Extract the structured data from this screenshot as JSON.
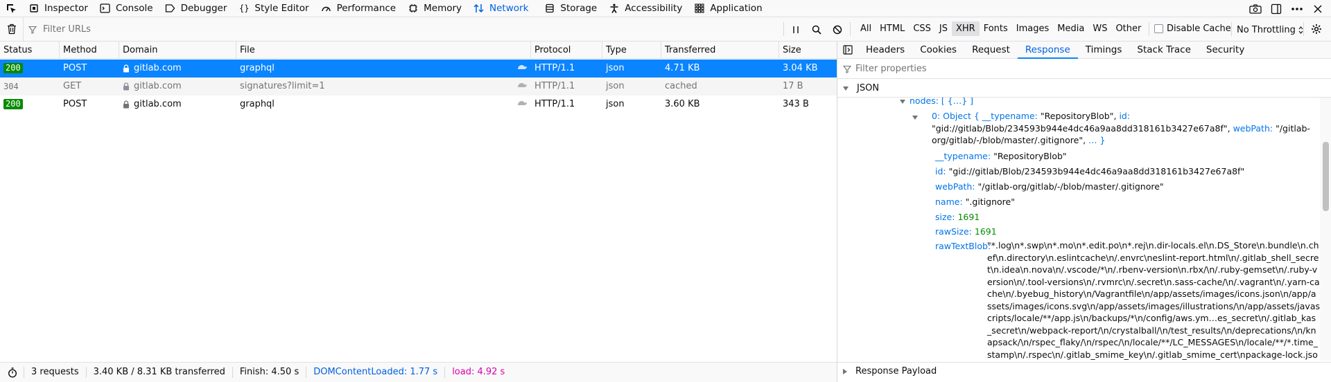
{
  "toolbox": {
    "tabs": [
      {
        "label": "Inspector",
        "icon": "inspector-icon"
      },
      {
        "label": "Console",
        "icon": "console-icon"
      },
      {
        "label": "Debugger",
        "icon": "debugger-icon"
      },
      {
        "label": "Style Editor",
        "icon": "style-editor-icon"
      },
      {
        "label": "Performance",
        "icon": "performance-icon"
      },
      {
        "label": "Memory",
        "icon": "memory-icon"
      },
      {
        "label": "Network",
        "icon": "network-icon",
        "selected": true
      },
      {
        "label": "Storage",
        "icon": "storage-icon"
      },
      {
        "label": "Accessibility",
        "icon": "accessibility-icon"
      },
      {
        "label": "Application",
        "icon": "application-icon"
      }
    ]
  },
  "network_toolbar": {
    "filter_placeholder": "Filter URLs",
    "type_filters": [
      "All",
      "HTML",
      "CSS",
      "JS",
      "XHR",
      "Fonts",
      "Images",
      "Media",
      "WS",
      "Other"
    ],
    "active_filter": "XHR",
    "disable_cache_label": "Disable Cache",
    "throttling_label": "No Throttling"
  },
  "table": {
    "headers": [
      "Status",
      "Method",
      "Domain",
      "File",
      "Protocol",
      "Type",
      "Transferred",
      "Size"
    ],
    "rows": [
      {
        "status": "200",
        "method": "POST",
        "domain": "gitlab.com",
        "file": "graphql",
        "protocol": "HTTP/1.1",
        "type": "json",
        "transferred": "4.71 KB",
        "size": "3.04 KB"
      },
      {
        "status": "304",
        "method": "GET",
        "domain": "gitlab.com",
        "file": "signatures?limit=1",
        "protocol": "HTTP/1.1",
        "type": "json",
        "transferred": "cached",
        "size": "17 B"
      },
      {
        "status": "200",
        "method": "POST",
        "domain": "gitlab.com",
        "file": "graphql",
        "protocol": "HTTP/1.1",
        "type": "json",
        "transferred": "3.60 KB",
        "size": "343 B"
      }
    ]
  },
  "statusbar": {
    "requests": "3 requests",
    "transferred": "3.40 KB / 8.31 KB transferred",
    "finish": "Finish: 4.50 s",
    "dcl": "DOMContentLoaded: 1.77 s",
    "load": "load: 4.92 s"
  },
  "side_panel": {
    "tabs": [
      "Headers",
      "Cookies",
      "Request",
      "Response",
      "Timings",
      "Stack Trace",
      "Security"
    ],
    "selected_tab": "Response",
    "filter_placeholder": "Filter properties",
    "json_section": "JSON",
    "payload_section": "Response Payload",
    "json": {
      "nodes_line_key": "nodes:",
      "nodes_line_val": "[ {…} ]",
      "obj_index": "0:",
      "obj_word": "Object",
      "obj_open": "{",
      "obj_typename_key": "__typename:",
      "obj_typename_val": "\"RepositoryBlob\"",
      "obj_id_key": "id:",
      "obj_id_val": "\"gid://gitlab/Blob/234593b944e4dc46a9aa8dd318161b3427e67a8f\"",
      "obj_webpath_key": "webPath:",
      "obj_webpath_val": "\"/gitlab-org/gitlab/-/blob/master/.gitignore\"",
      "obj_more": "… }",
      "typename_key": "__typename:",
      "typename_val": "\"RepositoryBlob\"",
      "id_key": "id:",
      "id_val": "\"gid://gitlab/Blob/234593b944e4dc46a9aa8dd318161b3427e67a8f\"",
      "webpath_key": "webPath:",
      "webpath_val": "\"/gitlab-org/gitlab/-/blob/master/.gitignore\"",
      "name_key": "name:",
      "name_val": "\".gitignore\"",
      "size_key": "size:",
      "size_val": "1691",
      "rawsize_key": "rawSize:",
      "rawsize_val": "1691",
      "rawtext_key": "rawTextBlob:",
      "rawtext_val": "\"*.log\\n*.swp\\n*.mo\\n*.edit.po\\n*.rej\\n.dir-locals.el\\n.DS_Store\\n.bundle\\n.chef\\n.directory\\n.eslintcache\\n/.envrc\\neslint-report.html\\n/.gitlab_shell_secret\\n.idea\\n.nova\\n/.vscode/*\\n/.rbenv-version\\n.rbx/\\n/.ruby-gemset\\n/.ruby-version\\n/.tool-versions\\n/.rvmrc\\n/.secret\\n.sass-cache/\\n/.vagrant\\n/.yarn-cache\\n/.byebug_history\\n/Vagrantfile\\n/app/assets/images/icons.json\\n/app/assets/images/icons.svg\\n/app/assets/images/illustrations/\\n/app/assets/javascripts/locale/**/app.js\\n/backups/*\\n/config/aws.ym…es_secret\\n/.gitlab_kas_secret\\n/webpack-report/\\n/crystalball/\\n/test_results/\\n/deprecations/\\n/knapsack/\\n/rspec_flaky/\\n/rspec/\\n/locale/**/LC_MESSAGES\\n/locale/**/*.time_stamp\\n/.rspec\\n/.gitlab_smime_key\\n/.gitlab_smime_cert\\npackage-lock.json"
    }
  }
}
